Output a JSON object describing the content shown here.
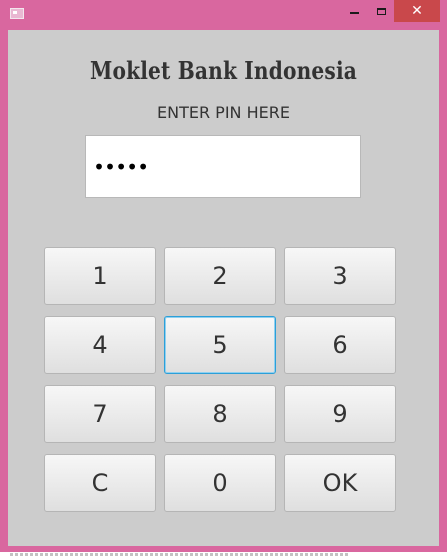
{
  "window": {
    "icons": {
      "app": "app-icon",
      "minimize": "minimize-icon",
      "maximize": "maximize-icon",
      "close": "close-icon"
    },
    "close_glyph": "✕",
    "accent_color": "#d9679f",
    "close_color": "#c9484b"
  },
  "header": {
    "bank_name": "Moklet Bank Indonesia",
    "instruction": "ENTER PIN HERE"
  },
  "pin": {
    "value": "•••••"
  },
  "keypad": {
    "keys": [
      "1",
      "2",
      "3",
      "4",
      "5",
      "6",
      "7",
      "8",
      "9",
      "C",
      "0",
      "OK"
    ],
    "focused_key": "5"
  }
}
